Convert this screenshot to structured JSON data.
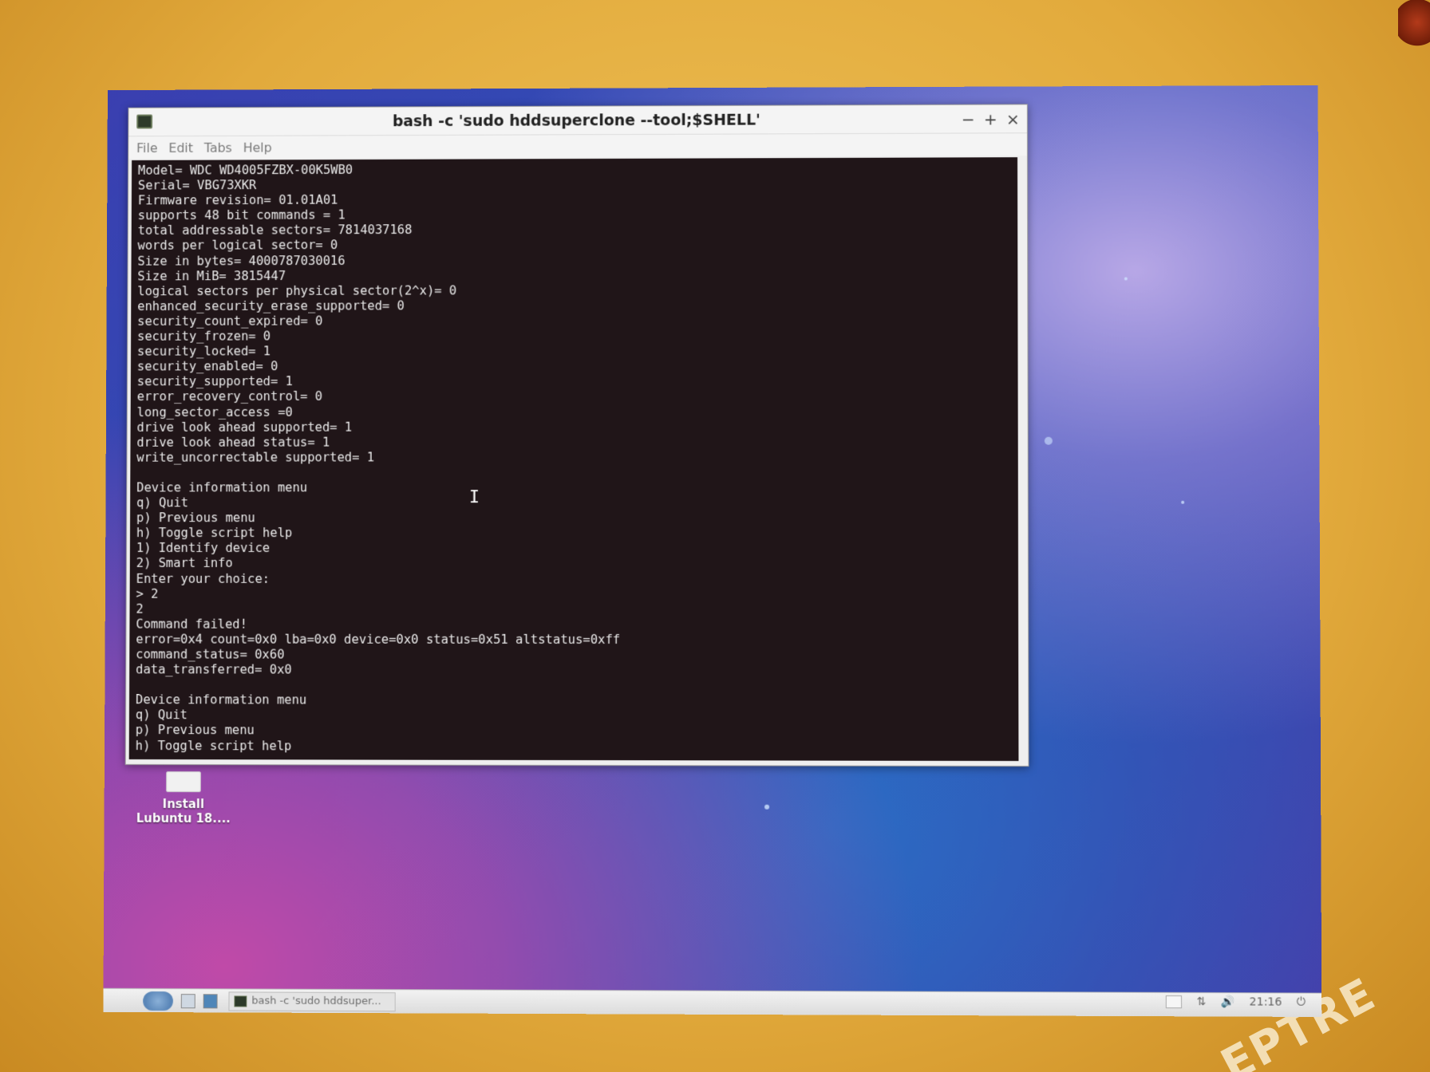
{
  "window": {
    "title": "bash -c 'sudo hddsuperclone --tool;$SHELL'",
    "controls": {
      "minimize": "−",
      "maximize": "+",
      "close": "×"
    }
  },
  "menu": [
    "File",
    "Edit",
    "Tabs",
    "Help"
  ],
  "terminal": {
    "lines": [
      "Model= WDC WD4005FZBX-00K5WB0",
      "Serial= VBG73XKR",
      "Firmware revision= 01.01A01",
      "supports 48 bit commands = 1",
      "total addressable sectors= 7814037168",
      "words per logical sector= 0",
      "Size in bytes= 4000787030016",
      "Size in MiB= 3815447",
      "logical sectors per physical sector(2^x)= 0",
      "enhanced_security_erase_supported= 0",
      "security_count_expired= 0",
      "security_frozen= 0",
      "security_locked= 1",
      "security_enabled= 0",
      "security_supported= 1",
      "error_recovery_control= 0",
      "long_sector_access =0",
      "drive look ahead supported= 1",
      "drive look ahead status= 1",
      "write_uncorrectable supported= 1",
      "",
      "Device information menu",
      "q) Quit",
      "p) Previous menu",
      "h) Toggle script help",
      "1) Identify device",
      "2) Smart info",
      "Enter your choice:",
      "> 2",
      "2",
      "Command failed!",
      "error=0x4 count=0x0 lba=0x0 device=0x0 status=0x51 altstatus=0xff",
      "command_status= 0x60",
      "data_transferred= 0x0",
      "",
      "Device information menu",
      "q) Quit",
      "p) Previous menu",
      "h) Toggle script help"
    ],
    "cursor_glyph": "I"
  },
  "desktop_icon": {
    "label_line1": "Install",
    "label_line2": "Lubuntu 18...."
  },
  "taskbar": {
    "task_label": "bash -c 'sudo hddsuper...",
    "clock": "21:16",
    "power_glyph": "⏻",
    "volume_glyph": "🔊"
  },
  "bezel": {
    "brand": "EPTRE"
  },
  "colors": {
    "terminal_bg": "#201518",
    "terminal_fg": "#eaeaea",
    "bezel": "#e2aa3c",
    "desktop_blue": "#2a55b8",
    "desktop_purple": "#c04aa8"
  }
}
